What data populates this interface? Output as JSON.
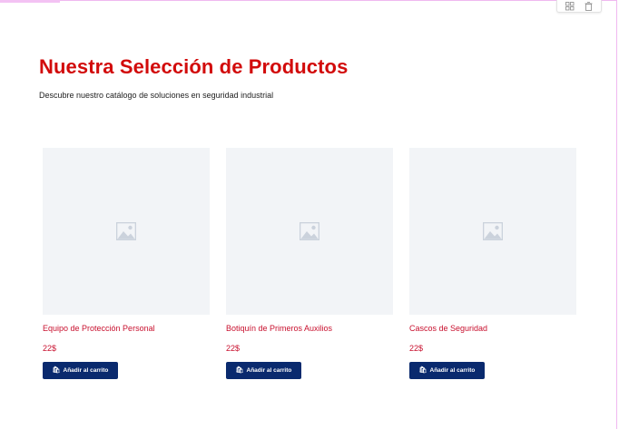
{
  "section": {
    "title": "Nuestra Selección de Productos",
    "subtitle": "Descubre nuestro catálogo de soluciones en seguridad industrial"
  },
  "products": [
    {
      "name": "Equipo de Protección Personal",
      "price": "22$",
      "button_label": "Añadir al carrito"
    },
    {
      "name": "Botiquín de Primeros Auxilios",
      "price": "22$",
      "button_label": "Añadir al carrito"
    },
    {
      "name": "Cascos de Seguridad",
      "price": "22$",
      "button_label": "Añadir al carrito"
    }
  ],
  "colors": {
    "title": "#d20b0b",
    "product_text": "#c8102e",
    "button_bg": "#0a2a6e",
    "placeholder_bg": "#f2f4f7",
    "frame_border": "#f0b8f0"
  },
  "icons": {
    "toolbar": [
      "copy-icon",
      "trash-icon"
    ],
    "product_image": "image-placeholder-icon",
    "button": "cart-icon"
  }
}
